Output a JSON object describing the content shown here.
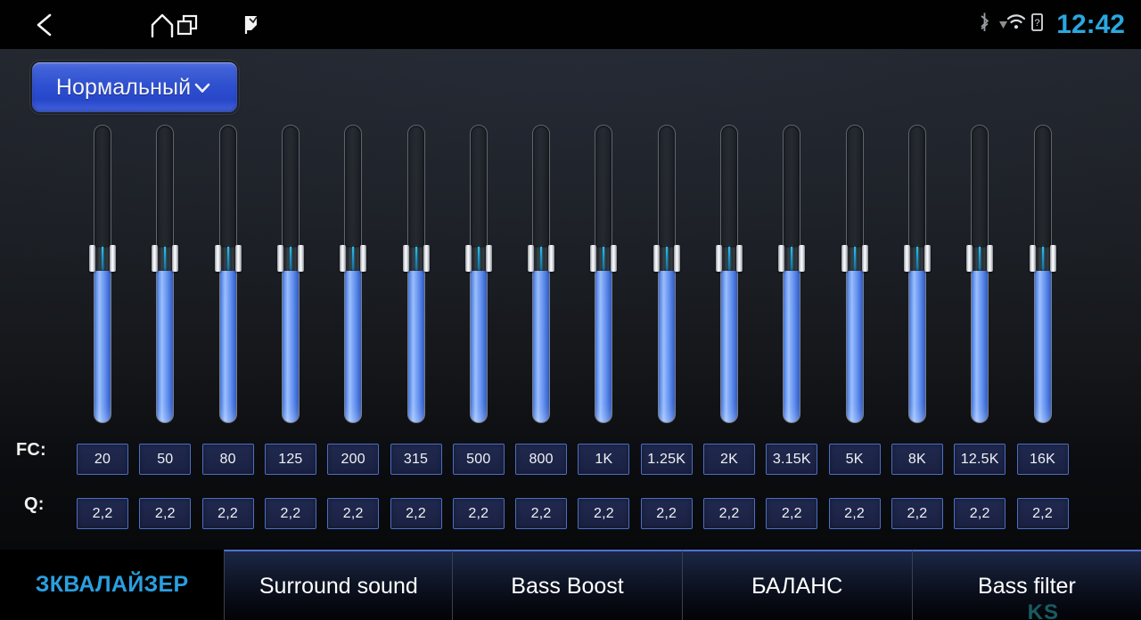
{
  "statusbar": {
    "nav": [
      {
        "name": "back-icon",
        "label": "Back"
      },
      {
        "name": "home-icon",
        "label": "Home"
      },
      {
        "name": "recents-icon",
        "label": "Recent apps"
      },
      {
        "name": "flag-icon",
        "label": "Flag"
      }
    ],
    "icons": [
      "bluetooth-icon",
      "wifi-icon",
      "sim-card-icon"
    ],
    "time": "12:42",
    "time_color": "#29a8e0"
  },
  "preset": {
    "label": "Нормальный",
    "caret": "chevron-down-icon",
    "accent": "#2d4fd6"
  },
  "equalizer": {
    "fc_row_label": "FC:",
    "q_row_label": "Q:",
    "bands": [
      {
        "fc": "20",
        "q": "2,2",
        "level": 55
      },
      {
        "fc": "50",
        "q": "2,2",
        "level": 55
      },
      {
        "fc": "80",
        "q": "2,2",
        "level": 55
      },
      {
        "fc": "125",
        "q": "2,2",
        "level": 55
      },
      {
        "fc": "200",
        "q": "2,2",
        "level": 55
      },
      {
        "fc": "315",
        "q": "2,2",
        "level": 55
      },
      {
        "fc": "500",
        "q": "2,2",
        "level": 55
      },
      {
        "fc": "800",
        "q": "2,2",
        "level": 55
      },
      {
        "fc": "1K",
        "q": "2,2",
        "level": 55
      },
      {
        "fc": "1.25K",
        "q": "2,2",
        "level": 55
      },
      {
        "fc": "2K",
        "q": "2,2",
        "level": 55
      },
      {
        "fc": "3.15K",
        "q": "2,2",
        "level": 55
      },
      {
        "fc": "5K",
        "q": "2,2",
        "level": 55
      },
      {
        "fc": "8K",
        "q": "2,2",
        "level": 55
      },
      {
        "fc": "12.5K",
        "q": "2,2",
        "level": 55
      },
      {
        "fc": "16K",
        "q": "2,2",
        "level": 55
      }
    ],
    "slider_fill_color": "#6f9cf2",
    "slider_track_color": "#63676d"
  },
  "tabs": [
    {
      "id": "eq",
      "label": "ЗКВАЛАЙЗЕР",
      "active": true
    },
    {
      "id": "surround",
      "label": "Surround sound",
      "active": false
    },
    {
      "id": "bassboost",
      "label": "Bass Boost",
      "active": false
    },
    {
      "id": "balance",
      "label": "БАЛАНС",
      "active": false
    },
    {
      "id": "bassfilter",
      "label": "Bass filter",
      "active": false
    }
  ],
  "tab_active_color": "#2a9fe0",
  "watermark": "KS"
}
